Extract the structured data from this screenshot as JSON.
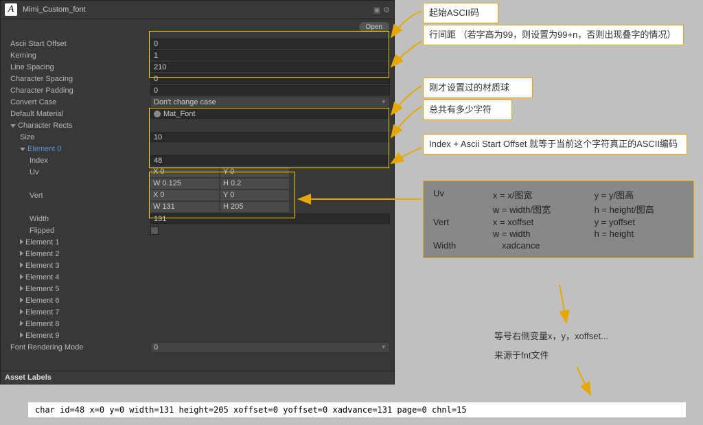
{
  "header": {
    "title": "Mimi_Custom_font",
    "open": "Open"
  },
  "props": {
    "asciiStart": {
      "label": "Ascii Start Offset",
      "value": "0"
    },
    "kerning": {
      "label": "Kerning",
      "value": "1"
    },
    "lineSpacing": {
      "label": "Line Spacing",
      "value": "210"
    },
    "charSpacing": {
      "label": "Character Spacing",
      "value": "0"
    },
    "charPadding": {
      "label": "Character Padding",
      "value": "0"
    },
    "convertCase": {
      "label": "Convert Case",
      "value": "Don't change case"
    },
    "defMaterial": {
      "label": "Default Material",
      "value": "Mat_Font"
    },
    "charRects": {
      "label": "Character Rects"
    },
    "size": {
      "label": "Size",
      "value": "10"
    },
    "element0": {
      "label": "Element 0"
    },
    "index": {
      "label": "Index",
      "value": "48"
    },
    "uv": {
      "label": "Uv",
      "x": "X 0",
      "y": "Y 0",
      "w": "W 0.125",
      "h": "H 0.2"
    },
    "vert": {
      "label": "Vert",
      "x": "X 0",
      "y": "Y 0",
      "w": "W 131",
      "h": "H 205"
    },
    "width": {
      "label": "Width",
      "value": "131"
    },
    "flipped": {
      "label": "Flipped"
    },
    "elements": [
      "Element 1",
      "Element 2",
      "Element 3",
      "Element 4",
      "Element 5",
      "Element 6",
      "Element 7",
      "Element 8",
      "Element 9"
    ],
    "renderMode": {
      "label": "Font Rendering Mode",
      "value": "0"
    }
  },
  "assetLabels": "Asset Labels",
  "annot": {
    "a1": "起始ASCII码",
    "a2": "行间距 （若字高为99，则设置为99+n，否则出现叠字的情况）",
    "a3": "刚才设置过的材质球",
    "a4": "总共有多少字符",
    "a5": "Index + Ascii Start Offset  就等于当前这个字符真正的ASCII编码"
  },
  "formula": {
    "uv": {
      "name": "Uv",
      "x": "x = x/图宽",
      "y": "y = y/图高",
      "w": "w = width/图宽",
      "h": "h = height/图高"
    },
    "vert": {
      "name": "Vert",
      "x": "x = xoffset",
      "y": "y = yoffset",
      "w": "w = width",
      "h": "h = height"
    },
    "width": {
      "name": "Width",
      "val": "xadcance"
    }
  },
  "notes": {
    "n1": "等号右侧变量x，y，xoffset...",
    "n2": "来源于fnt文件"
  },
  "fntLine": "char  id=48    x=0      y=0       width=131    height=205    xoffset=0     yoffset=0     xadvance=131    page=0   chnl=15"
}
